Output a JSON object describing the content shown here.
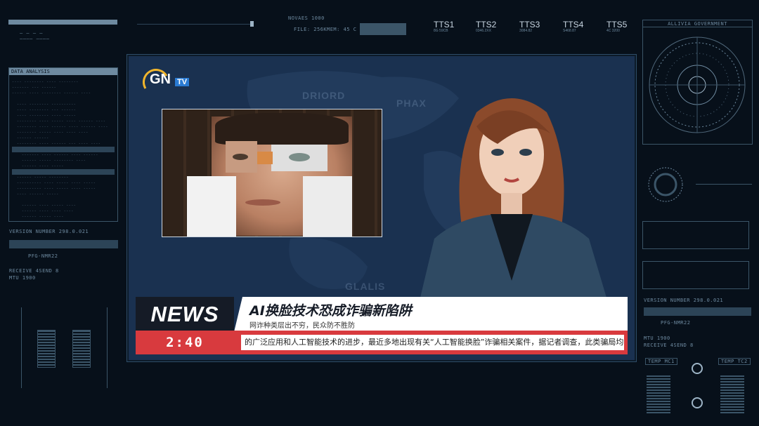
{
  "hud": {
    "top_left_label": "DATA ANALYSIS",
    "version_left": "VERSION NUMBER 298.0.021",
    "pfg_left": "PFG-NMR22",
    "receive_left": "RECEIVE 4SEND 8",
    "mtu_left": "MTU 1900",
    "status_labels": [
      "NOVAES 1000",
      "FILE: 256K",
      "MEM: 45 C"
    ],
    "tts": [
      {
        "label": "TTS1",
        "sub": "8G 59CB"
      },
      {
        "label": "TTS2",
        "sub": "0346.2XX"
      },
      {
        "label": "TTS3",
        "sub": "3084.82"
      },
      {
        "label": "TTS4",
        "sub": "S468.87"
      },
      {
        "label": "TTS5",
        "sub": "4C 3200"
      }
    ],
    "gov_label": "ALLIVIA GOVERNMENT",
    "version_right": "VERSION NUMBER 298.0.021",
    "pfg_right": "PFG-NMR22",
    "mtu_right": "MTU 1900",
    "receive_right": "RECEIVE 4SEND 8",
    "temp1": "TEMP MC1",
    "temp2": "TEMP TC2"
  },
  "broadcast": {
    "logo_text": "GN",
    "logo_tv": "TV",
    "map_labels": [
      "DRIORD",
      "PHAX",
      "GLALIS"
    ],
    "news_label": "NEWS",
    "headline": "AI换脸技术恐成诈骗新陷阱",
    "subheadline": "网诈种类层出不穷，民众防不胜防",
    "time": "2:40",
    "ticker": "的广泛应用和人工智能技术的进步，最近多地出现有关“人工智能换脸”诈骗相关案件，据记者调查，此类骗局均易"
  },
  "colors": {
    "accent_red": "#d83a3e",
    "screen_bg": "#1a3150",
    "hud_bg": "#07101a"
  }
}
